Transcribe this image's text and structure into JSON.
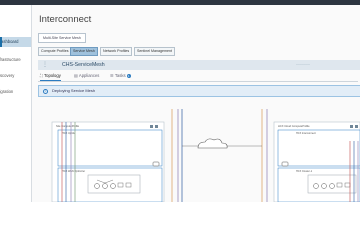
{
  "page": {
    "title": "Interconnect",
    "multi_site_chip": "Multi-Site Service Mesh"
  },
  "sidebar": {
    "items": [
      {
        "label": "Dashboard",
        "active": true
      },
      {
        "label": "Infrastructure",
        "active": false
      },
      {
        "label": "Discovery",
        "active": false
      },
      {
        "label": "Migration",
        "active": false
      }
    ]
  },
  "main_tabs": [
    {
      "label": "Compute Profiles",
      "active": false
    },
    {
      "label": "Service Mesh",
      "active": true
    },
    {
      "label": "Network Profiles",
      "active": false
    },
    {
      "label": "Sentinel Management",
      "active": false
    }
  ],
  "mesh": {
    "name": "CHS-ServiceMesh",
    "subtabs": [
      {
        "label": "Topology",
        "active": true
      },
      {
        "label": "Appliances",
        "active": false
      },
      {
        "label": "Tasks",
        "active": false,
        "badge": "1"
      }
    ],
    "banner": "Deploying Service Mesh"
  },
  "topology": {
    "left_site_label": "Site ComputeProfile",
    "left_inner_label": "HCX Uplink",
    "left_lower_label": "HCX WAN Optimizer",
    "right_site_label": "HCX Cloud ComputeProfile",
    "right_inner_label": "HCX Interconnect",
    "right_lower_label": "HCX Cluster-1"
  },
  "colors": {
    "accent": "#2c7cc1",
    "topbar": "#2d3540",
    "line_orange": "#d89a55",
    "line_purple": "#8a7ab0",
    "line_red": "#c04a4a",
    "line_blue": "#2c5aa0"
  }
}
